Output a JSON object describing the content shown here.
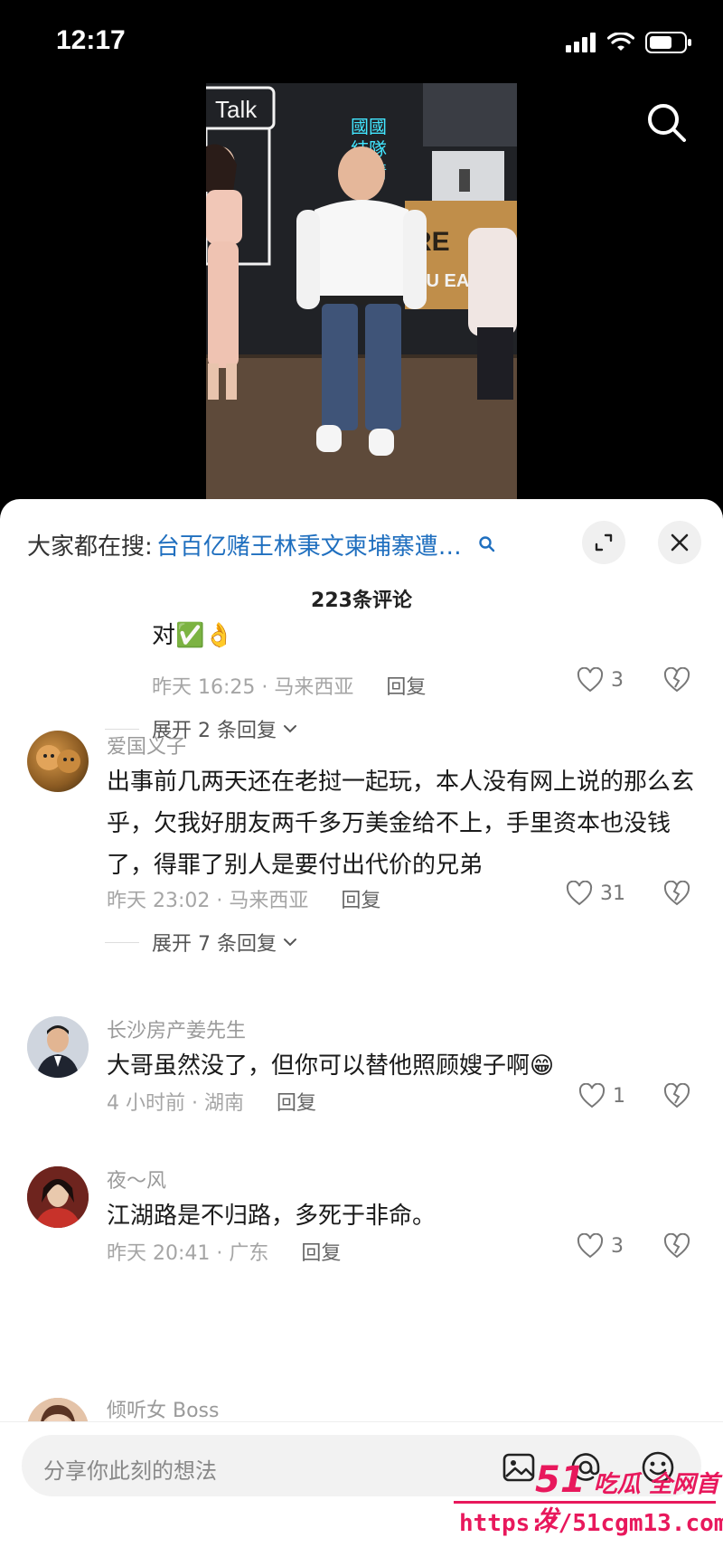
{
  "status_bar": {
    "time": "12:17"
  },
  "video": {
    "scene_texts": {
      "sign_talk": "Talk",
      "sign_re": "RE",
      "sign_ou": "OU EA",
      "neon": "國際精神"
    }
  },
  "hot_search": {
    "label": "大家都在搜:",
    "query": "台百亿赌王林秉文柬埔寨遭…"
  },
  "comment_count": "223条评论",
  "comments": [
    {
      "text": "对✅👌",
      "meta": "昨天 16:25 · 马来西亚",
      "reply": "回复",
      "likes": "3",
      "expand": "展开 2 条回复"
    },
    {
      "user": "爱国义子",
      "text": "出事前几两天还在老挝一起玩，本人没有网上说的那么玄乎，欠我好朋友两千多万美金给不上，手里资本也没钱了，得罪了别人是要付出代价的兄弟",
      "meta": "昨天 23:02 · 马来西亚",
      "reply": "回复",
      "likes": "31",
      "expand": "展开 7 条回复"
    },
    {
      "user": "长沙房产姜先生",
      "text": "大哥虽然没了，但你可以替他照顾嫂子啊😁",
      "meta": "4 小时前 · 湖南",
      "reply": "回复",
      "likes": "1"
    },
    {
      "user": "夜～风",
      "text": "江湖路是不归路，多死于非命。",
      "meta": "昨天 20:41 · 广东",
      "reply": "回复",
      "likes": "3"
    },
    {
      "user": "倾听女 Boss"
    }
  ],
  "input": {
    "placeholder": "分享你此刻的想法"
  },
  "watermark": {
    "brand_num": "51",
    "brand_text": "吃瓜 全网首发",
    "url": "https://51cgm13.com"
  },
  "colors": {
    "accent_link": "#1f6fbf",
    "watermark": "#e8185c"
  }
}
